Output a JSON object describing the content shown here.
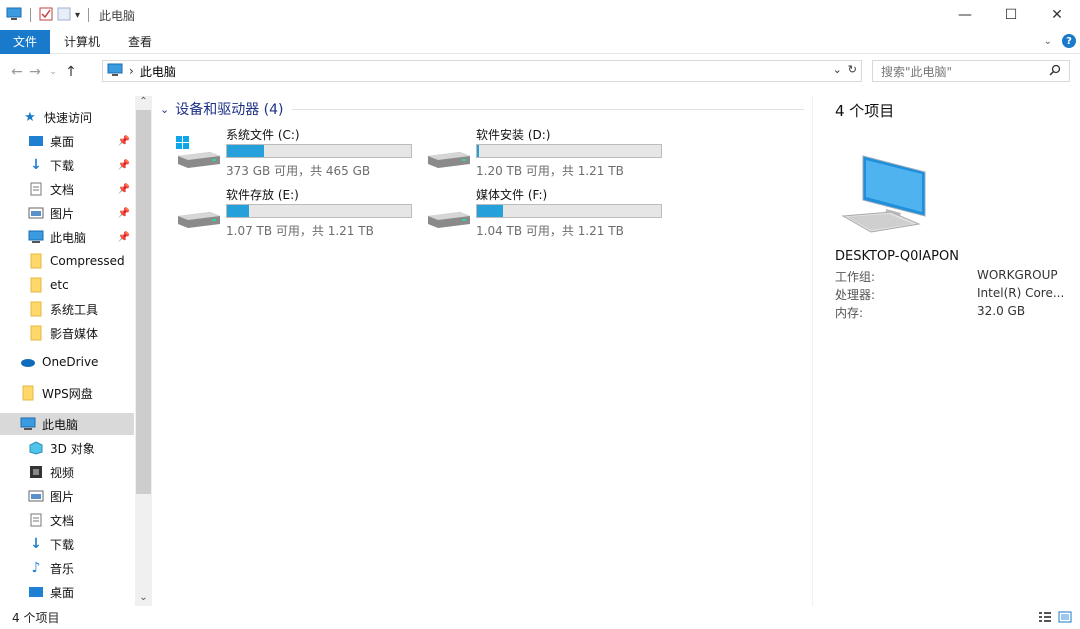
{
  "window": {
    "title": "此电脑",
    "controls": {
      "minimize": "—",
      "maximize": "☐",
      "close": "✕"
    }
  },
  "ribbon": {
    "tabs": [
      "文件",
      "计算机",
      "查看"
    ],
    "help": "?"
  },
  "address": {
    "path": "此电脑",
    "search_placeholder": "搜索\"此电脑\""
  },
  "nav": {
    "quick_access": "快速访问",
    "quick_items": [
      {
        "label": "桌面",
        "icon": "desktop-icon",
        "pinned": true
      },
      {
        "label": "下载",
        "icon": "download-icon",
        "pinned": true
      },
      {
        "label": "文档",
        "icon": "document-icon",
        "pinned": true
      },
      {
        "label": "图片",
        "icon": "picture-icon",
        "pinned": true
      },
      {
        "label": "此电脑",
        "icon": "computer-icon",
        "pinned": true
      },
      {
        "label": "Compressed",
        "icon": "folder-icon",
        "pinned": false
      },
      {
        "label": "etc",
        "icon": "folder-icon",
        "pinned": false
      },
      {
        "label": "系统工具",
        "icon": "folder-icon",
        "pinned": false
      },
      {
        "label": "影音媒体",
        "icon": "folder-icon",
        "pinned": false
      }
    ],
    "onedrive": "OneDrive",
    "wps": "WPS网盘",
    "this_pc": "此电脑",
    "pc_items": [
      {
        "label": "3D 对象",
        "icon": "3d-objects-icon"
      },
      {
        "label": "视频",
        "icon": "video-icon"
      },
      {
        "label": "图片",
        "icon": "picture-icon"
      },
      {
        "label": "文档",
        "icon": "document-icon"
      },
      {
        "label": "下载",
        "icon": "download-icon"
      },
      {
        "label": "音乐",
        "icon": "music-icon"
      },
      {
        "label": "桌面",
        "icon": "desktop-icon"
      }
    ]
  },
  "main": {
    "group_title": "设备和驱动器 (4)",
    "drives": [
      {
        "name": "系统文件 (C:)",
        "space": "373 GB 可用，共 465 GB",
        "used_fraction": 0.2,
        "system": true
      },
      {
        "name": "软件安装 (D:)",
        "space": "1.20 TB 可用，共 1.21 TB",
        "used_fraction": 0.01,
        "system": false
      },
      {
        "name": "软件存放 (E:)",
        "space": "1.07 TB 可用，共 1.21 TB",
        "used_fraction": 0.12,
        "system": false
      },
      {
        "name": "媒体文件 (F:)",
        "space": "1.04 TB 可用，共 1.21 TB",
        "used_fraction": 0.14,
        "system": false
      }
    ]
  },
  "details": {
    "count": "4 个项目",
    "computer_name": "DESKTOP-Q0IAPON",
    "rows": [
      {
        "label": "工作组:",
        "value": "WORKGROUP"
      },
      {
        "label": "处理器:",
        "value": "Intel(R) Core..."
      },
      {
        "label": "内存:",
        "value": "32.0 GB"
      }
    ]
  },
  "status": {
    "items": "4 个项目"
  },
  "colors": {
    "accent": "#1979ca",
    "bar_fill": "#26a0da",
    "group_header": "#1e3287"
  }
}
